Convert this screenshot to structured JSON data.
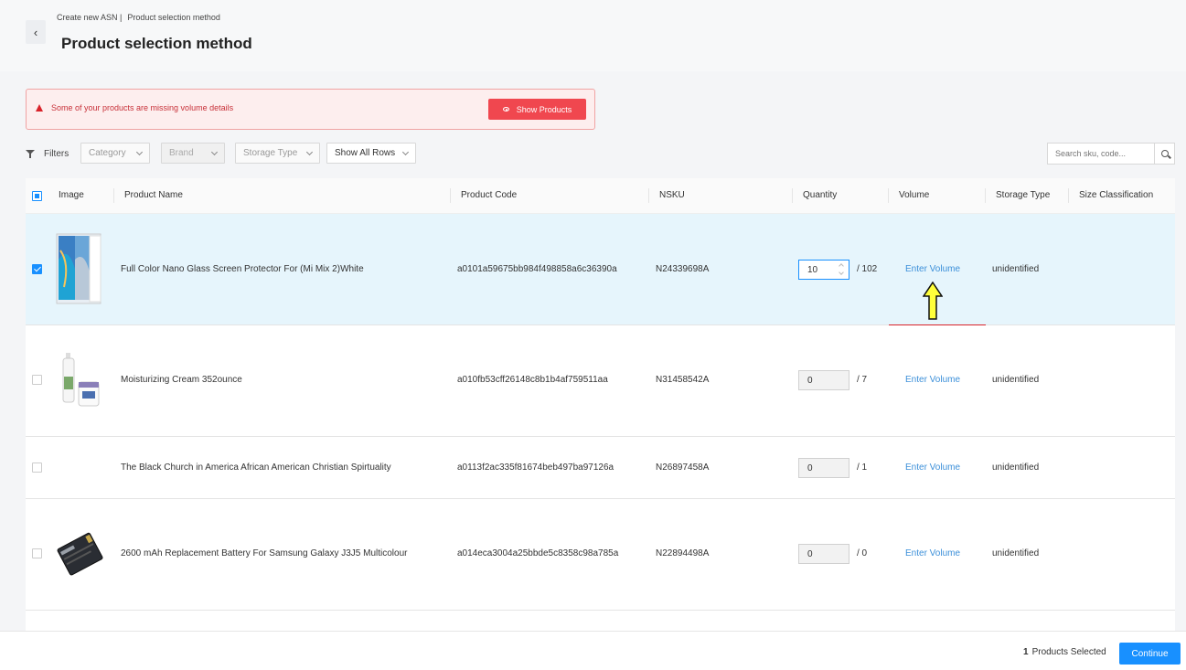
{
  "header": {
    "breadcrumb": [
      "Create new ASN |",
      "Product selection method"
    ],
    "title": "Product selection method"
  },
  "alert": {
    "message": "Some of your products are missing volume details",
    "button_label": "Show Products"
  },
  "filters": {
    "label": "Filters",
    "category": "Category",
    "brand": "Brand",
    "storage_type": "Storage Type",
    "rows": "Show All Rows",
    "search_placeholder": "Search sku, code..."
  },
  "table": {
    "columns": [
      "Image",
      "Product Name",
      "Product Code",
      "NSKU",
      "Quantity",
      "Volume",
      "Storage Type",
      "Size Classification"
    ],
    "rows": [
      {
        "selected": true,
        "image": "screen-protector",
        "name": "Full Color Nano Glass Screen Protector For (Mi Mix 2)White",
        "code": "a0101a59675bb984f498858a6c36390a",
        "nsku": "N24339698A",
        "qty": "10",
        "max": "/ 102",
        "volume": "Enter Volume",
        "storage": "unidentified",
        "size": ""
      },
      {
        "selected": false,
        "image": "cream-bottle",
        "name": "Moisturizing Cream 352ounce",
        "code": "a010fb53cff26148c8b1b4af759511aa",
        "nsku": "N31458542A",
        "qty": "0",
        "max": "/ 7",
        "volume": "Enter Volume",
        "storage": "unidentified",
        "size": ""
      },
      {
        "selected": false,
        "image": "",
        "name": "The Black Church in America African American Christian Spirtuality",
        "code": "a0113f2ac335f81674beb497ba97126a",
        "nsku": "N26897458A",
        "qty": "0",
        "max": "/ 1",
        "volume": "Enter Volume",
        "storage": "unidentified",
        "size": ""
      },
      {
        "selected": false,
        "image": "battery",
        "name": "2600 mAh Replacement Battery For Samsung Galaxy J3J5 Multicolour",
        "code": "a014eca3004a25bbde5c8358c98a785a",
        "nsku": "N22894498A",
        "qty": "0",
        "max": "/ 0",
        "volume": "Enter Volume",
        "storage": "unidentified",
        "size": ""
      }
    ]
  },
  "footer": {
    "selected_count": "1",
    "selected_label": "Products Selected",
    "continue_label": "Continue"
  },
  "colors": {
    "primary": "#1890ff",
    "danger": "#f0474f",
    "selected_row": "#e6f5fc"
  }
}
